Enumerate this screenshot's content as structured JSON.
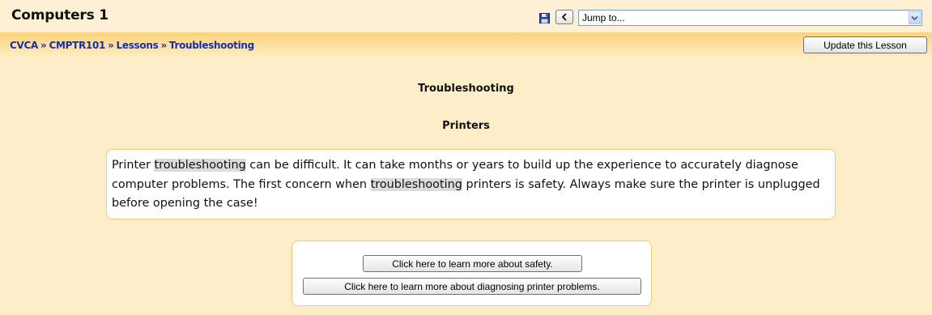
{
  "header": {
    "course_title": "Computers 1",
    "jump_placeholder": "Jump to...",
    "icons": {
      "save": "save-icon",
      "prev": "chevron-left-icon",
      "dropdown": "chevron-down-icon"
    }
  },
  "navbar": {
    "breadcrumb": [
      {
        "label": "CVCA"
      },
      {
        "label": "CMPTR101"
      },
      {
        "label": "Lessons"
      },
      {
        "label": "Troubleshooting"
      }
    ],
    "separator": "»",
    "update_button": "Update this Lesson"
  },
  "lesson": {
    "title": "Troubleshooting",
    "page_title": "Printers",
    "content": {
      "part1": "Printer ",
      "highlight1": "troubleshooting",
      "part2": " can be difficult. It can take months or years to build up the experience to accurately diagnose computer problems. The first concern when ",
      "highlight2": "troubleshooting",
      "part3": " printers is safety. Always make sure the printer is unplugged before opening the case!"
    },
    "choices": [
      {
        "label": "Click here to learn more about safety."
      },
      {
        "label": "Click here to learn more about diagnosing printer problems."
      }
    ]
  },
  "colors": {
    "page_background": "#fdedc9",
    "navbar_gradient_top": "#fbd37e",
    "link_blue": "#1a2fa6",
    "box_border": "#f5c878",
    "highlight": "#dcdcdc"
  }
}
